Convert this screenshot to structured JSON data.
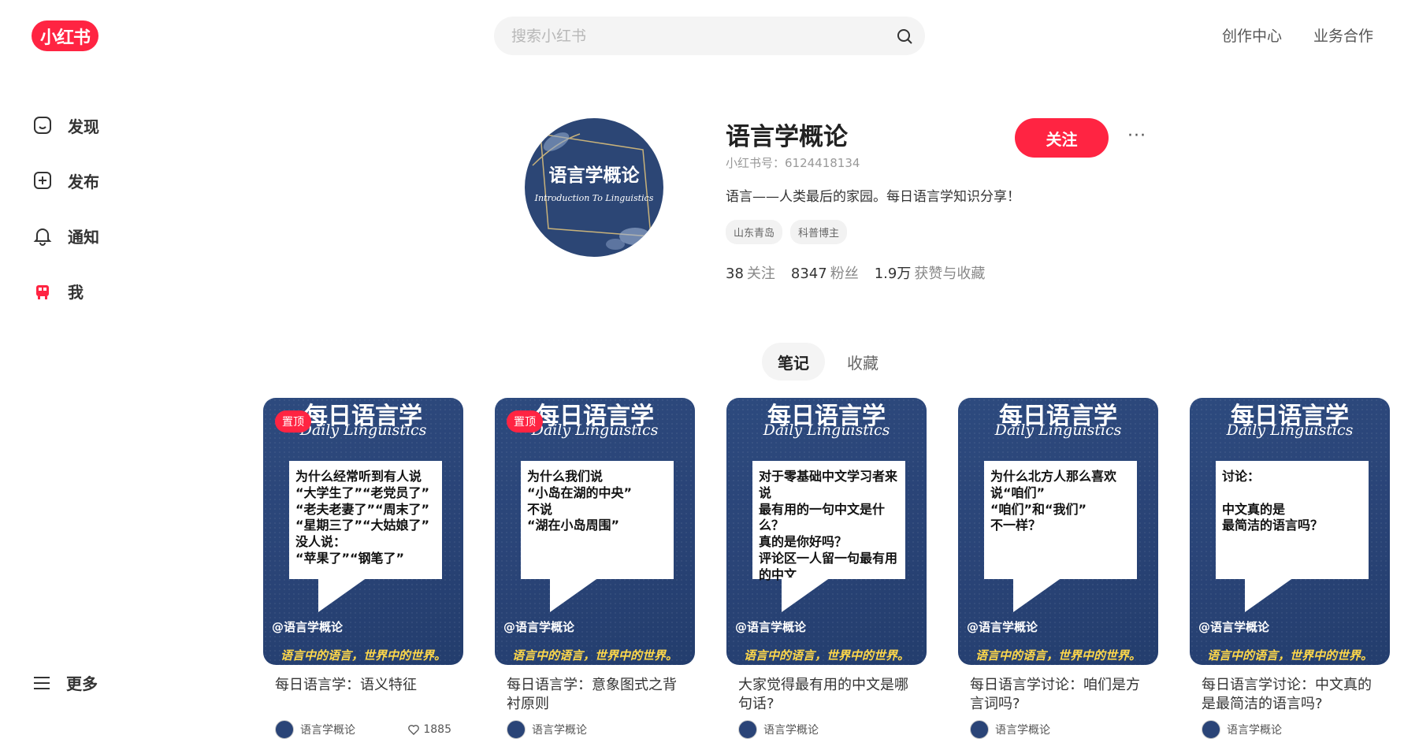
{
  "brand": {
    "logo_text": "小红书",
    "color": "#ff2442"
  },
  "search": {
    "placeholder": "搜索小红书"
  },
  "top_links": [
    "创作中心",
    "业务合作"
  ],
  "sidebar": {
    "items": [
      {
        "label": "发现",
        "icon": "home-icon"
      },
      {
        "label": "发布",
        "icon": "plus-square-icon"
      },
      {
        "label": "通知",
        "icon": "bell-icon"
      },
      {
        "label": "我",
        "icon": "user-avatar-icon"
      }
    ],
    "more_label": "更多"
  },
  "profile": {
    "avatar_title": "语言学概论",
    "avatar_subtitle": "Introduction To Linguistics",
    "name": "语言学概论",
    "id_text": "小红书号：6124418134",
    "bio": "语言——人类最后的家园。每日语言学知识分享！",
    "tags": [
      "山东青岛",
      "科普博主"
    ],
    "follow_label": "关注",
    "more_label": "···",
    "stats": [
      {
        "value": "38",
        "label": "关注"
      },
      {
        "value": "8347",
        "label": "粉丝"
      },
      {
        "value": "1.9万",
        "label": "获赞与收藏"
      }
    ]
  },
  "tabs": [
    {
      "label": "笔记",
      "active": true
    },
    {
      "label": "收藏",
      "active": false
    }
  ],
  "cover_common": {
    "title_cn": "每日语言学",
    "title_en": "Daily Linguistics",
    "handle": "@语言学概论",
    "slogan": "语言中的语言，世界中的世界。"
  },
  "notes": [
    {
      "pinned": true,
      "pin_label": "置顶",
      "bubble": "为什么经常听到有人说\n“大学生了”“老党员了”\n“老夫老妻了”“周末了”\n“星期三了”“大姑娘了”\n没人说：\n“苹果了”“钢笔了”",
      "title": "每日语言学：语义特征",
      "author": "语言学概论",
      "likes": "1885"
    },
    {
      "pinned": true,
      "pin_label": "置顶",
      "bubble": "为什么我们说\n“小岛在湖的中央”\n不说\n“湖在小岛周围”",
      "title": "每日语言学：意象图式之背衬原则",
      "author": "语言学概论",
      "likes": ""
    },
    {
      "pinned": false,
      "pin_label": "",
      "bubble": "对于零基础中文学习者来说\n最有用的一句中文是什么？\n真的是你好吗？\n评论区一人留一句最有用的中文",
      "title": "大家觉得最有用的中文是哪句话?",
      "author": "语言学概论",
      "likes": ""
    },
    {
      "pinned": false,
      "pin_label": "",
      "bubble": "为什么北方人那么喜欢\n说“咱们”\n“咱们”和“我们”\n不一样？",
      "title": "每日语言学讨论：咱们是方言词吗?",
      "author": "语言学概论",
      "likes": ""
    },
    {
      "pinned": false,
      "pin_label": "",
      "bubble": "讨论：\n\n中文真的是\n最简洁的语言吗？",
      "title": "每日语言学讨论：中文真的是最简洁的语言吗?",
      "author": "语言学概论",
      "likes": ""
    }
  ]
}
